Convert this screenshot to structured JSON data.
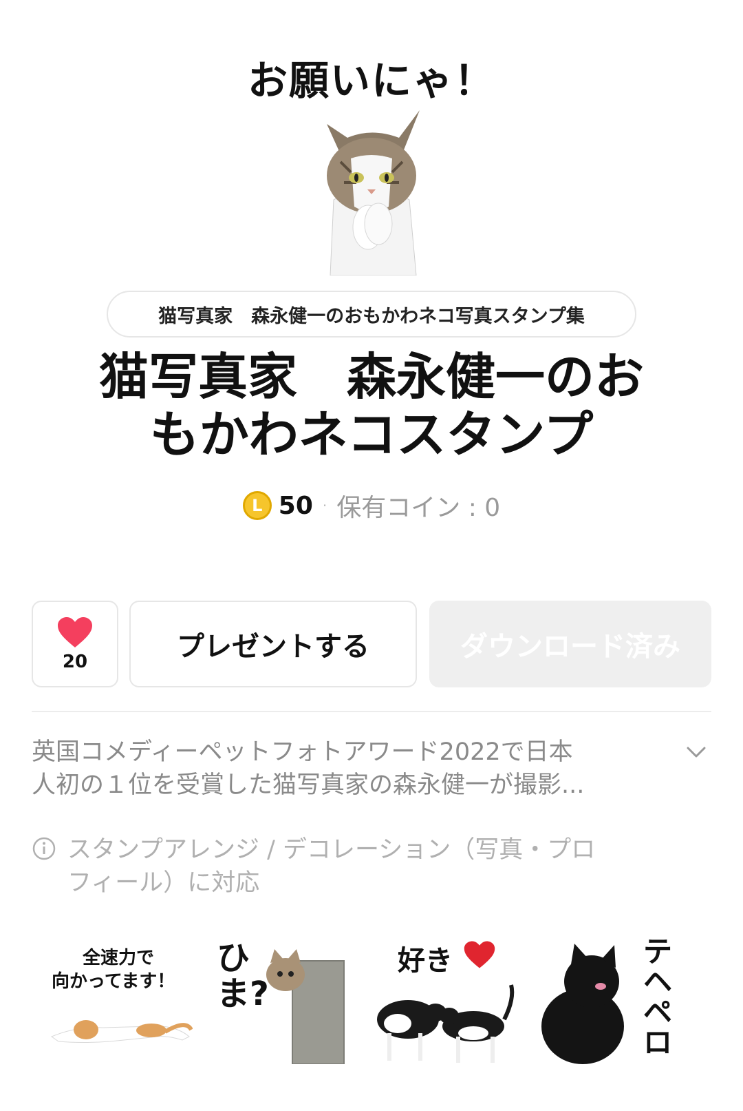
{
  "hero": {
    "caption": "お願いにゃ！",
    "image": "cat-praying-sticker"
  },
  "pack_chip": "猫写真家　森永健一のおもかわネコ写真スタンプ集",
  "title_lines": [
    "猫写真家　森永健一のお",
    "もかわネコスタンプ"
  ],
  "price": {
    "coin_icon": "L",
    "amount": "50",
    "separator": "·",
    "owned": "保有コイン : 0"
  },
  "actions": {
    "like_count": "20",
    "gift_label": "プレゼントする",
    "download_label": "ダウンロード済み"
  },
  "description": {
    "line1": "英国コメディーペットフォトアワード2022で日本",
    "line2": "人初の１位を受賞した猫写真家の森永健一が撮影..."
  },
  "notice": {
    "line1": "スタンプアレンジ / デコレーション（写真・プロ",
    "line2": "フィール）に対応"
  },
  "stickers": [
    {
      "line1": "全速力で",
      "line2": "向かってます！"
    },
    {
      "text": "ひま?"
    },
    {
      "text": "好き"
    },
    {
      "text": "テヘペロ"
    }
  ],
  "colors": {
    "heart": "#f43f5e",
    "coin": "#f6c52c",
    "muted_text": "#8a8a8a",
    "disabled_bg": "#efefef"
  }
}
